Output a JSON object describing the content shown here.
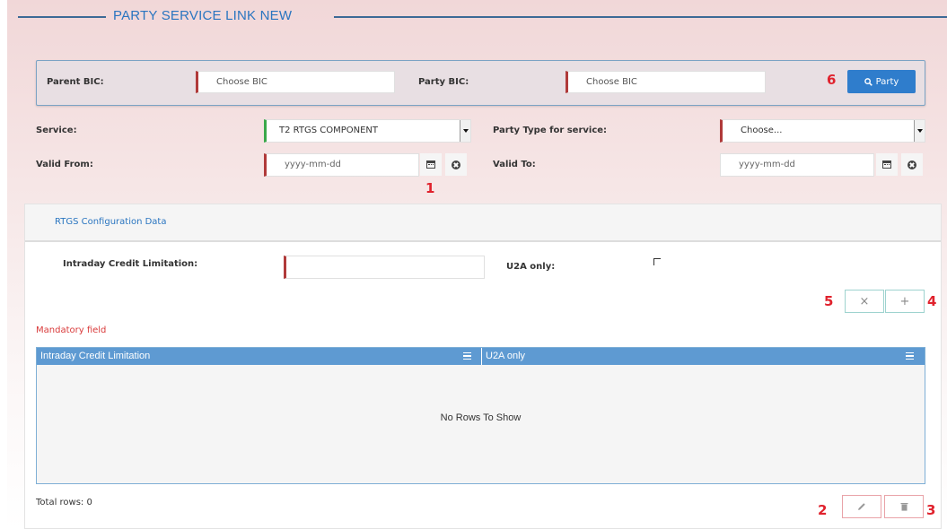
{
  "header": {
    "title": "PARTY SERVICE LINK NEW"
  },
  "bic_panel": {
    "parent_bic_label": "Parent BIC:",
    "parent_bic_placeholder": "Choose BIC",
    "party_bic_label": "Party BIC:",
    "party_bic_placeholder": "Choose BIC",
    "party_button_label": "Party"
  },
  "form": {
    "service_label": "Service:",
    "service_value": "T2 RTGS COMPONENT",
    "party_type_label": "Party Type for service:",
    "party_type_value": "Choose...",
    "valid_from_label": "Valid From:",
    "valid_from_placeholder": "yyyy-mm-dd",
    "valid_to_label": "Valid To:",
    "valid_to_placeholder": "yyyy-mm-dd"
  },
  "rtgs_section": {
    "tab_label": "RTGS Configuration Data",
    "intraday_label": "Intraday Credit Limitation:",
    "intraday_value": "",
    "u2a_label": "U2A only:",
    "mandatory_text": "Mandatory field",
    "grid": {
      "columns": [
        "Intraday Credit Limitation",
        "U2A only"
      ],
      "rows": [],
      "empty_text": "No Rows To Show",
      "total_rows_text": "Total rows: 0"
    }
  },
  "annotations": [
    "1",
    "2",
    "3",
    "4",
    "5",
    "6"
  ],
  "colors": {
    "accent": "#2a75c0",
    "primary_button": "#2f7dcc",
    "required_marker": "#b03a3a",
    "valid_marker": "#3aa84a",
    "annotation": "#e0222d",
    "grid_header": "#5e9ad2"
  },
  "icons": {
    "party_button": "search-icon",
    "calendar": "calendar-icon",
    "clear": "clear-circle-icon",
    "cancel": "close-icon",
    "add": "plus-icon",
    "edit": "pencil-icon",
    "delete": "trash-icon",
    "column_menu": "menu-icon"
  }
}
